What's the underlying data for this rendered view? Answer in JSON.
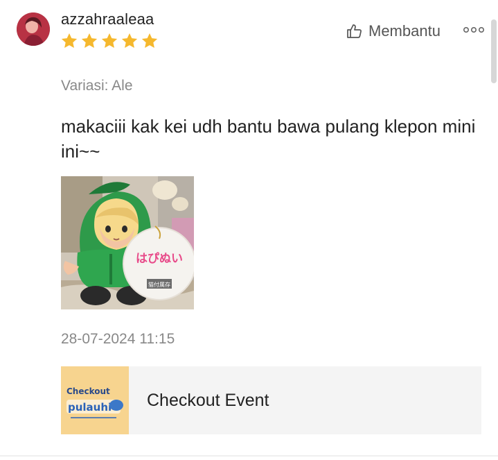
{
  "review": {
    "username": "azzahraaleaa",
    "rating": 5,
    "helpful_label": "Membantu",
    "variation": "Variasi: Ale",
    "text": "makaciii kak kei udh bantu bawa pulang klepon mini ini~~",
    "timestamp": "28-07-2024 11:15",
    "photo_tag_text": "はぴぬい",
    "photo_tag_sub": "猫付属存"
  },
  "event_card": {
    "title": "Checkout Event",
    "thumb_line1": "Checkout",
    "thumb_line2": "pulauhi"
  },
  "icons": {
    "thumb": "thumbs-up-icon",
    "more": "more-options-icon",
    "star": "star-icon"
  },
  "colors": {
    "star": "#f5b82e",
    "muted_text": "#888888",
    "event_thumb_bg": "#f7d48f",
    "card_bg": "#f4f4f4"
  }
}
